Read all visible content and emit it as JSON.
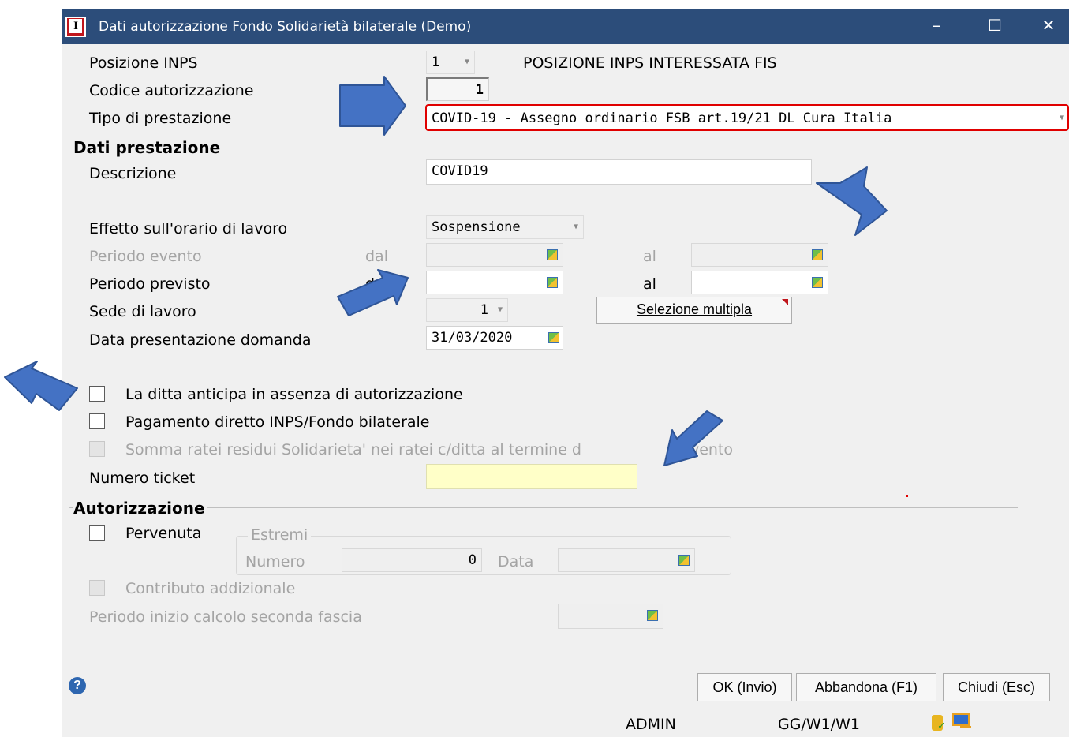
{
  "window": {
    "title": "Dati autorizzazione Fondo Solidarietà bilaterale  (Demo)",
    "controls": {
      "minimize": "–",
      "maximize": "☐",
      "close": "✕"
    }
  },
  "header": {
    "posizione_inps_label": "Posizione INPS",
    "posizione_inps_value": "1",
    "posizione_inps_desc": "POSIZIONE INPS INTERESSATA FIS",
    "codice_autorizzazione_label": "Codice autorizzazione",
    "codice_autorizzazione_value": "1",
    "tipo_prestazione_label": "Tipo di prestazione",
    "tipo_prestazione_value": "COVID-19 - Assegno ordinario FSB art.19/21 DL Cura Italia"
  },
  "dati_prestazione": {
    "title": "Dati prestazione",
    "descrizione_label": "Descrizione",
    "descrizione_value": "COVID19",
    "effetto_label": "Effetto sull'orario di lavoro",
    "effetto_value": "Sospensione",
    "periodo_evento_label": "Periodo evento",
    "periodo_previsto_label": "Periodo previsto",
    "dal_label": "dal",
    "dal_label_partial": "d",
    "al_label": "al",
    "sede_label": "Sede di lavoro",
    "sede_value": "1",
    "selezione_multipla": "Selezione multipla",
    "data_presentazione_label": "Data presentazione domanda",
    "data_presentazione_value": "31/03/2020",
    "anticipa_label": "La ditta anticipa in assenza di autorizzazione",
    "pagamento_label": "Pagamento diretto INPS/Fondo bilaterale",
    "somma_label": "Somma ratei residui Solidarieta' nei ratei c/ditta al termine d",
    "somma_label_tail": "vento",
    "numero_ticket_label": "Numero ticket",
    "numero_ticket_value": ""
  },
  "autorizzazione": {
    "title": "Autorizzazione",
    "pervenuta_label": "Pervenuta",
    "estremi_title": "Estremi",
    "numero_label": "Numero",
    "numero_value": "0",
    "data_label": "Data",
    "contributo_label": "Contributo addizionale",
    "periodo_inizio_label": "Periodo inizio calcolo seconda fascia"
  },
  "buttons": {
    "ok": "OK (Invio)",
    "abbandona": "Abbandona (F1)",
    "chiudi": "Chiudi (Esc)",
    "help": "?"
  },
  "statusbar": {
    "user": "ADMIN",
    "path": "GG/W1/W1"
  },
  "colors": {
    "titlebar": "#2c4d7a",
    "arrow": "#4472c4",
    "highlight_border": "#e00000",
    "ticket_bg": "#ffffc8"
  }
}
